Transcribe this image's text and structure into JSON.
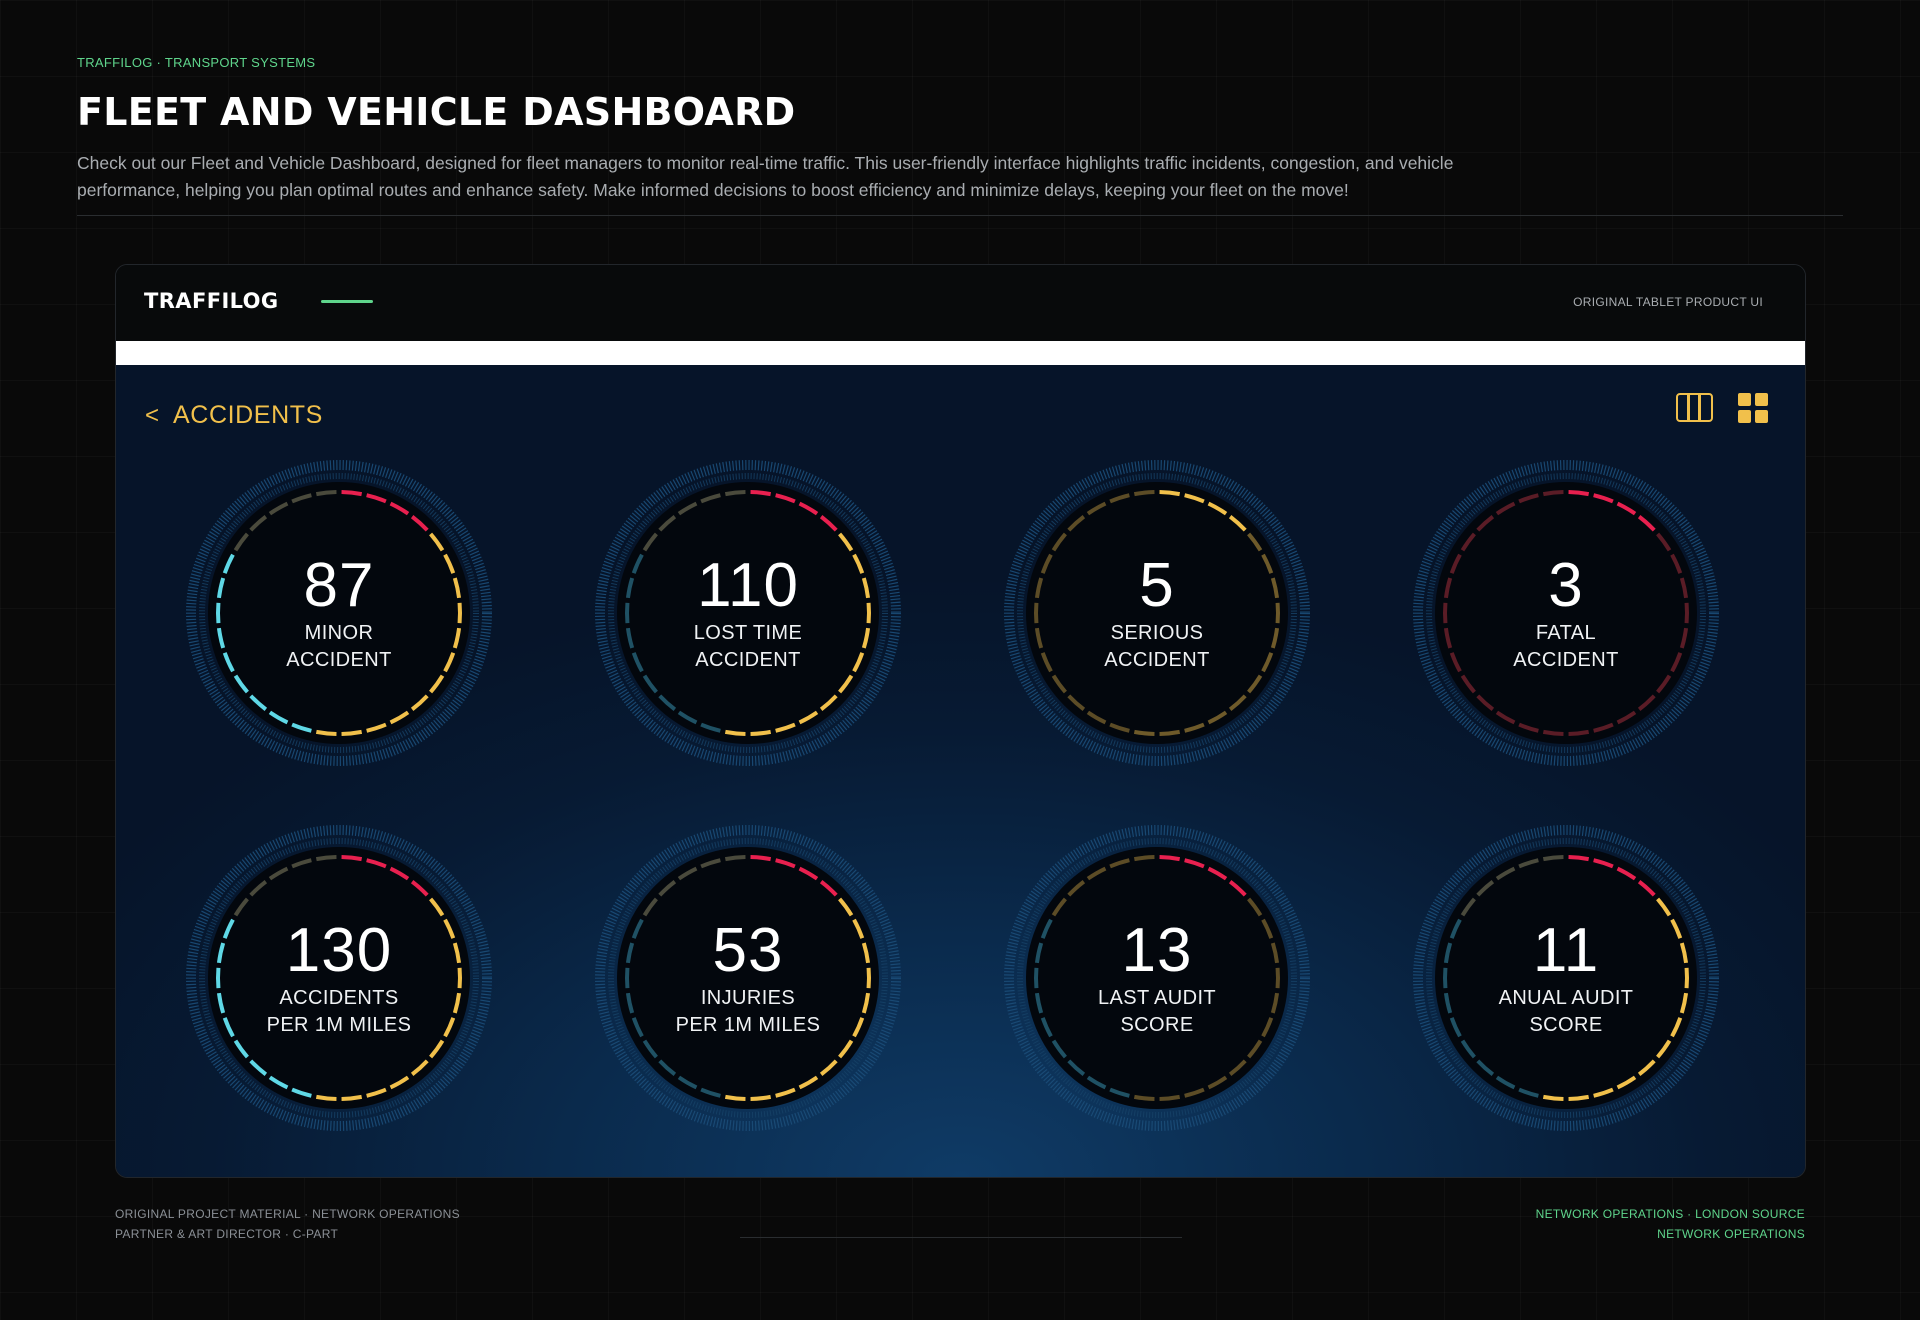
{
  "page": {
    "eyebrow": "TRAFFILOG · TRANSPORT SYSTEMS",
    "title": "FLEET AND VEHICLE DASHBOARD",
    "description": "Check out our Fleet and Vehicle Dashboard, designed for fleet managers to monitor real-time traffic. This user-friendly interface highlights traffic incidents, congestion, and vehicle performance, helping you plan optimal routes and enhance safety. Make informed decisions to boost efficiency and minimize delays, keeping your fleet on the move!"
  },
  "frame": {
    "brand": "TRAFFILOG",
    "tag": "ORIGINAL TABLET PRODUCT UI"
  },
  "screen": {
    "back_icon": "chevron-left-icon",
    "back_chevron": "<",
    "title": "ACCIDENTS",
    "view_icons": [
      "columns-view-icon",
      "grid-view-icon"
    ]
  },
  "colors": {
    "accent_yellow": "#f1c04b",
    "accent_red": "#e8204f",
    "accent_cyan": "#5fd8e6",
    "accent_green": "#5fd58c",
    "screen_bg": "#0a2a4c"
  },
  "gauges": [
    {
      "value": "87",
      "label_lines": [
        "MINOR",
        "ACCIDENT"
      ],
      "style": "full"
    },
    {
      "value": "110",
      "label_lines": [
        "LOST TIME",
        "ACCIDENT"
      ],
      "style": "full-dim-left"
    },
    {
      "value": "5",
      "label_lines": [
        "SERIOUS",
        "ACCIDENT"
      ],
      "style": "amber"
    },
    {
      "value": "3",
      "label_lines": [
        "FATAL",
        "ACCIDENT"
      ],
      "style": "red"
    },
    {
      "value": "130",
      "label_lines": [
        "ACCIDENTS",
        "PER 1M MILES"
      ],
      "style": "full"
    },
    {
      "value": "53",
      "label_lines": [
        "INJURIES",
        "PER 1M MILES"
      ],
      "style": "full-dim-left"
    },
    {
      "value": "13",
      "label_lines": [
        "LAST AUDIT",
        "SCORE"
      ],
      "style": "dim-red-top"
    },
    {
      "value": "11",
      "label_lines": [
        "ANUAL AUDIT",
        "SCORE"
      ],
      "style": "full-dim-left"
    }
  ],
  "footer": {
    "left_line1": "ORIGINAL PROJECT MATERIAL · NETWORK OPERATIONS",
    "left_line2": "PARTNER & ART DIRECTOR · C-PART",
    "right_line1": "NETWORK OPERATIONS · LONDON SOURCE",
    "right_line2": "NETWORK OPERATIONS"
  }
}
